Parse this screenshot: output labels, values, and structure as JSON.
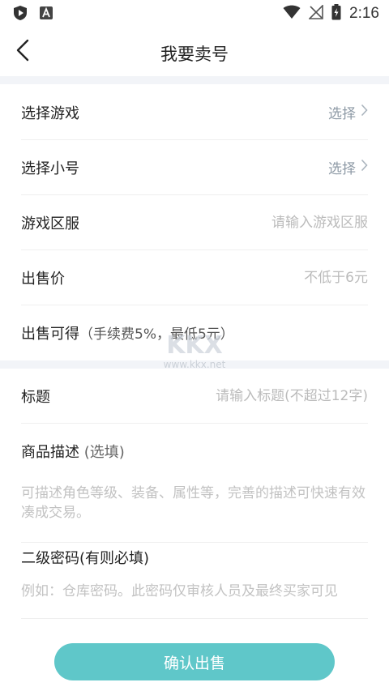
{
  "status_bar": {
    "time": "2:16",
    "icons": [
      "shield-play-icon",
      "app-a-icon",
      "wifi-icon",
      "no-signal-icon",
      "battery-charging-icon"
    ]
  },
  "header": {
    "title": "我要卖号",
    "back_icon": "chevron-left-icon"
  },
  "form": {
    "select_game": {
      "label": "选择游戏",
      "value": "选择"
    },
    "select_account": {
      "label": "选择小号",
      "value": "选择"
    },
    "game_server": {
      "label": "游戏区服",
      "placeholder": "请输入游戏区服"
    },
    "price": {
      "label": "出售价",
      "placeholder": "不低于6元"
    },
    "earnings": {
      "label": "出售可得",
      "note": "（手续费5%，最低5元）"
    },
    "title": {
      "label": "标题",
      "placeholder": "请输入标题(不超过12字)"
    },
    "description": {
      "label": "商品描述",
      "optional": "(选填)",
      "placeholder": "可描述角色等级、装备、属性等，完善的描述可快速有效凑成交易。"
    },
    "secondary_password": {
      "label": "二级密码(有则必填)",
      "placeholder": "例如：仓库密码。此密码仅审核人员及最终买家可见"
    }
  },
  "submit": {
    "label": "确认出售"
  },
  "watermark": {
    "text": "www.kkx.net",
    "logo": "KKX"
  },
  "colors": {
    "accent": "#5fc7c9",
    "section_gap": "#f2f4f8",
    "placeholder": "#bbbbbb",
    "select_text": "#8e9aa6"
  }
}
